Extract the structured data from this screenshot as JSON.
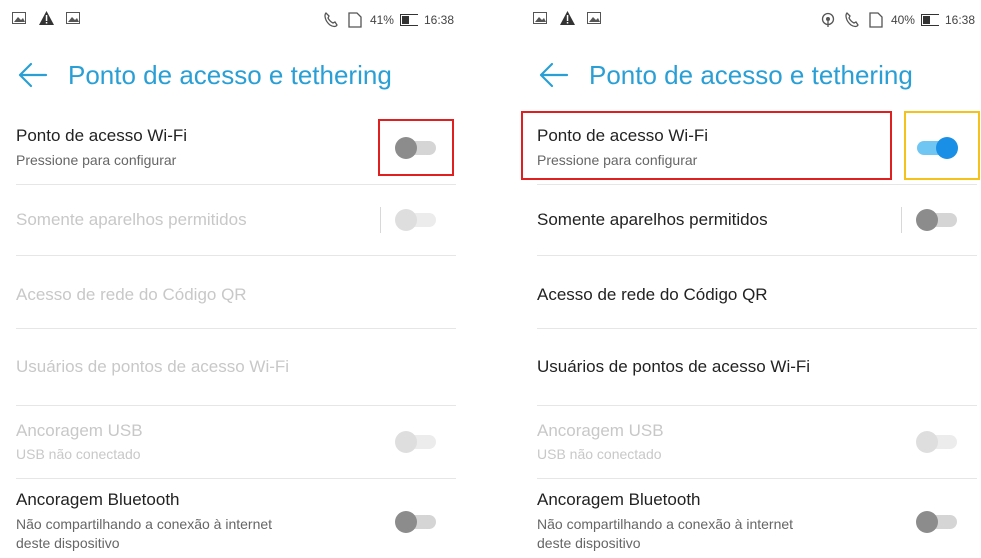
{
  "left": {
    "status": {
      "battery_pct": "41%",
      "time": "16:38"
    },
    "title": "Ponto de acesso e tethering",
    "rows": [
      {
        "title": "Ponto de acesso Wi-Fi",
        "subtitle": "Pressione para configurar",
        "toggle": "off",
        "enabled": true
      },
      {
        "title": "Somente aparelhos permitidos",
        "toggle": "off",
        "enabled": false
      },
      {
        "title": "Acesso de rede do Código QR",
        "enabled": false
      },
      {
        "title": "Usuários de pontos de acesso Wi-Fi",
        "enabled": false
      },
      {
        "title": "Ancoragem USB",
        "subtitle": "USB não conectado",
        "toggle": "off",
        "enabled": false
      },
      {
        "title": "Ancoragem Bluetooth",
        "subtitle": "Não compartilhando a conexão à internet",
        "subtitle2": "deste dispositivo",
        "toggle": "off",
        "enabled": true
      }
    ]
  },
  "right": {
    "status": {
      "battery_pct": "40%",
      "time": "16:38"
    },
    "title": "Ponto de acesso e tethering",
    "rows": [
      {
        "title": "Ponto de acesso Wi-Fi",
        "subtitle": "Pressione para configurar",
        "toggle": "on",
        "enabled": true
      },
      {
        "title": "Somente aparelhos permitidos",
        "toggle": "off",
        "enabled": true
      },
      {
        "title": "Acesso de rede do Código QR",
        "enabled": true
      },
      {
        "title": "Usuários de pontos de acesso Wi-Fi",
        "enabled": true
      },
      {
        "title": "Ancoragem USB",
        "subtitle": "USB não conectado",
        "toggle": "off",
        "enabled": false
      },
      {
        "title": "Ancoragem Bluetooth",
        "subtitle": "Não compartilhando a conexão à internet",
        "subtitle2": "deste dispositivo",
        "toggle": "off",
        "enabled": true
      }
    ]
  },
  "colors": {
    "accent": "#2a9fd6",
    "toggle_on": "#1a8fe6",
    "highlight_red": "#e02020",
    "highlight_yellow": "#f3c21b"
  },
  "icons": [
    "image-icon",
    "warning-icon",
    "image-icon",
    "hotspot-icon",
    "call-icon",
    "sim-icon",
    "battery-icon",
    "back-arrow-icon"
  ]
}
